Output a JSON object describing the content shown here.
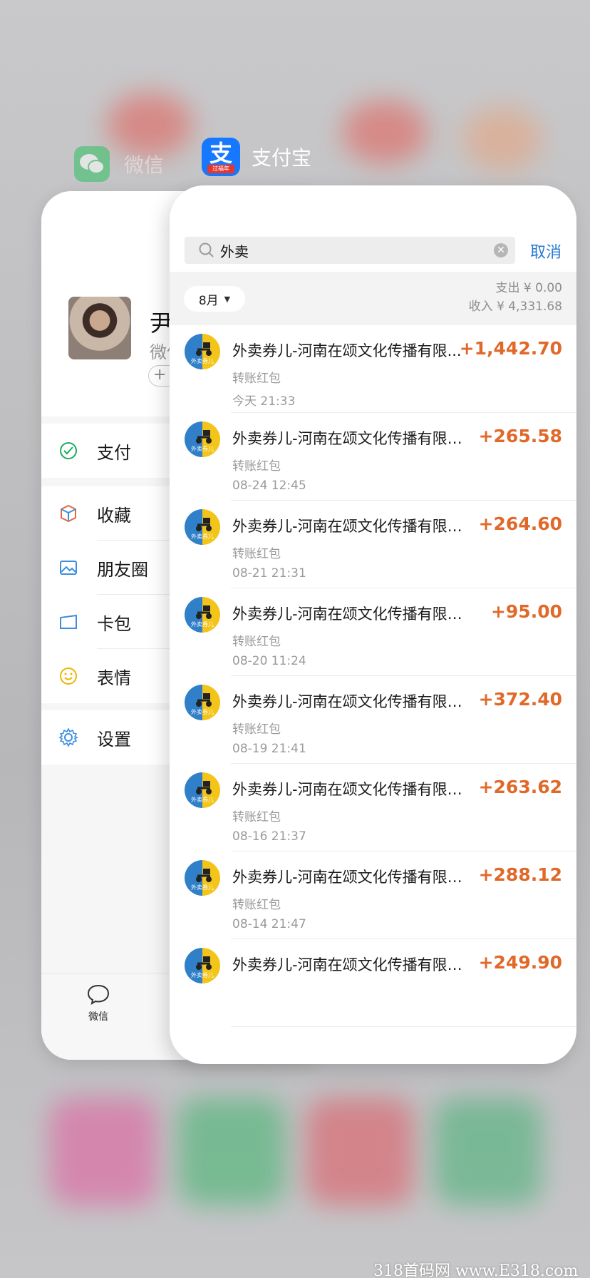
{
  "app_switcher": {
    "wechat_app_name": "微信",
    "alipay_app_name": "支付宝",
    "alipay_icon_glyph": "支",
    "alipay_icon_badge": "过福年"
  },
  "wechat": {
    "profile_name": "尹",
    "profile_id_prefix": "微信",
    "status_button": "+",
    "menu": [
      {
        "label": "支付",
        "icon": "wechat-pay-icon"
      },
      {
        "label": "收藏",
        "icon": "favorites-cube-icon"
      },
      {
        "label": "朋友圈",
        "icon": "moments-picture-icon"
      },
      {
        "label": "卡包",
        "icon": "card-wallet-icon"
      },
      {
        "label": "表情",
        "icon": "sticker-smile-icon"
      },
      {
        "label": "设置",
        "icon": "settings-gear-icon"
      }
    ],
    "tabbar": {
      "chats_label": "微信"
    }
  },
  "alipay": {
    "search": {
      "value": "外卖"
    },
    "cancel_label": "取消",
    "filter": {
      "month_label": "8月",
      "expense_text": "支出 ¥ 0.00",
      "income_text": "收入 ¥ 4,331.68"
    },
    "transactions": [
      {
        "title": "外卖券儿-河南在颂文化传播有限...",
        "amount": "+1,442.70",
        "category": "转账红包",
        "time": "今天  21:33"
      },
      {
        "title": "外卖券儿-河南在颂文化传播有限公...",
        "amount": "+265.58",
        "category": "转账红包",
        "time": "08-24  12:45"
      },
      {
        "title": "外卖券儿-河南在颂文化传播有限公...",
        "amount": "+264.60",
        "category": "转账红包",
        "time": "08-21  21:31"
      },
      {
        "title": "外卖券儿-河南在颂文化传播有限公司...",
        "amount": "+95.00",
        "category": "转账红包",
        "time": "08-20  11:24"
      },
      {
        "title": "外卖券儿-河南在颂文化传播有限公...",
        "amount": "+372.40",
        "category": "转账红包",
        "time": "08-19  21:41"
      },
      {
        "title": "外卖券儿-河南在颂文化传播有限公...",
        "amount": "+263.62",
        "category": "转账红包",
        "time": "08-16  21:37"
      },
      {
        "title": "外卖券儿-河南在颂文化传播有限公...",
        "amount": "+288.12",
        "category": "转账红包",
        "time": "08-14  21:47"
      },
      {
        "title": "外卖券儿-河南在颂文化传播有限公...",
        "amount": "+249.90",
        "category": "",
        "time": ""
      }
    ],
    "merchant_logo_text": "外卖券儿"
  },
  "watermark": "318首码网 www.E318.com",
  "colors": {
    "amount": "#e0692a",
    "cancel": "#2a79d3",
    "wechat_green": "#2dc160",
    "alipay_blue": "#1677ff"
  }
}
